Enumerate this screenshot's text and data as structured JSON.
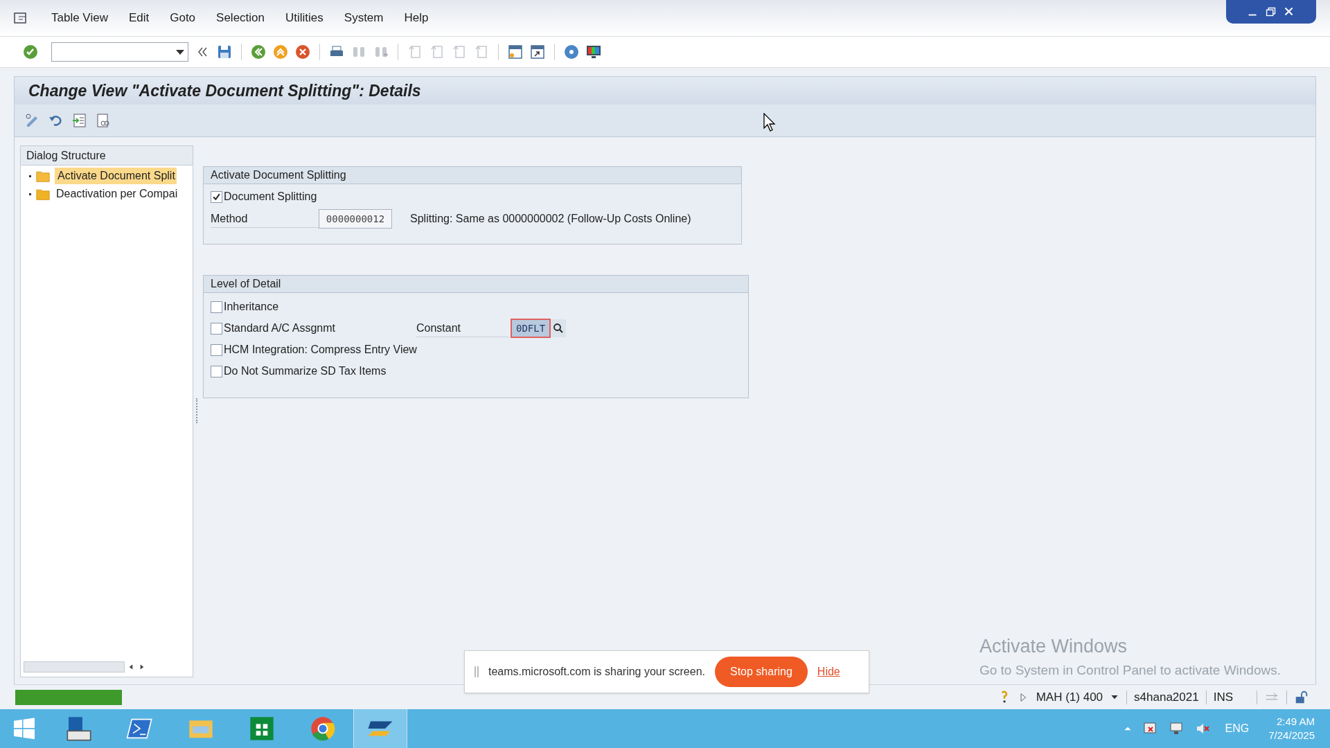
{
  "menu": [
    "Table View",
    "Edit",
    "Goto",
    "Selection",
    "Utilities",
    "System",
    "Help"
  ],
  "title": "Change View \"Activate Document Splitting\": Details",
  "dialog_structure": {
    "title": "Dialog Structure",
    "items": [
      {
        "label": "Activate Document Split",
        "selected": true
      },
      {
        "label": "Deactivation per Compai",
        "selected": false
      }
    ]
  },
  "group_split": {
    "title": "Activate Document Splitting",
    "checkbox": {
      "label": "Document Splitting",
      "checked": true
    },
    "method_label": "Method",
    "method_value": "0000000012",
    "method_text": "Splitting: Same as 0000000002 (Follow-Up Costs Online)"
  },
  "group_detail": {
    "title": "Level of Detail",
    "rows": [
      {
        "label": "Inheritance",
        "checked": false
      },
      {
        "label": "Standard A/C Assgnmt",
        "checked": false,
        "extra_label": "Constant",
        "extra_value": "0DFLT"
      },
      {
        "label": "HCM Integration: Compress Entry View",
        "checked": false
      },
      {
        "label": "Do Not Summarize SD Tax Items",
        "checked": false
      }
    ]
  },
  "activation_notice": {
    "title": "Activate Windows",
    "text": "Go to System in Control Panel to activate Windows."
  },
  "sharing_bar": {
    "text": "teams.microsoft.com is sharing your screen.",
    "stop": "Stop sharing",
    "hide": "Hide"
  },
  "status_bar": {
    "system": "MAH (1) 400",
    "server": "s4hana2021",
    "mode": "INS"
  },
  "taskbar": {
    "language": "ENG",
    "time": "2:49 AM",
    "date": "7/24/2025"
  }
}
